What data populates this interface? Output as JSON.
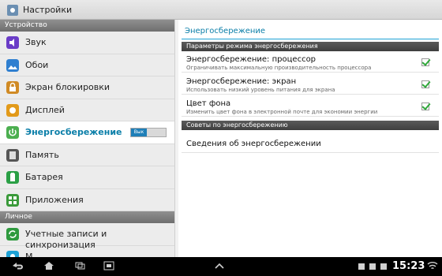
{
  "topbar": {
    "title": "Настройки",
    "icon": "settings-icon"
  },
  "sidebar": {
    "section_device": "Устройство",
    "items": [
      {
        "label": "Звук",
        "icon": "sound-icon",
        "color": "#6a3cc7"
      },
      {
        "label": "Обои",
        "icon": "wallpaper-icon",
        "color": "#2f7fd0"
      },
      {
        "label": "Экран блокировки",
        "icon": "lock-screen-icon",
        "color": "#d08a24"
      },
      {
        "label": "Дисплей",
        "icon": "display-icon",
        "color": "#e29a1a"
      },
      {
        "label": "Энергосбережение",
        "icon": "power-saving-icon",
        "color": "#4caf50",
        "selected": true,
        "toggle_label": "Вык"
      },
      {
        "label": "Память",
        "icon": "storage-icon",
        "color": "#555555"
      },
      {
        "label": "Батарея",
        "icon": "battery-icon",
        "color": "#2a9f45"
      },
      {
        "label": "Приложения",
        "icon": "apps-icon",
        "color": "#3a9a3a"
      }
    ],
    "section_personal": "Личное",
    "items2": [
      {
        "label": "Учетные записи и синхронизация",
        "icon": "sync-icon",
        "color": "#2e9a3e"
      },
      {
        "label": "М",
        "icon": "location-icon",
        "color": "#1ea2d6"
      }
    ]
  },
  "detail": {
    "title": "Энергосбережение",
    "header_params": "Параметры режима энергосбережения",
    "options": [
      {
        "title": "Энергосбережение: процессор",
        "subtitle": "Ограничивать максимальную производительность процессора",
        "checked": true
      },
      {
        "title": "Энергосбережение: экран",
        "subtitle": "Использовать низкий уровень питания для экрана",
        "checked": true
      },
      {
        "title": "Цвет фона",
        "subtitle": "Изменить цвет фона в электронной почте для экономии энергии",
        "checked": true
      }
    ],
    "header_tips": "Советы по энергосбережению",
    "tips_link": "Сведения об энергосбережении"
  },
  "bottombar": {
    "time": "15:23"
  },
  "colors": {
    "accent": "#1ea2d6",
    "selected_text": "#0a7ea8",
    "check": "#2fa83a"
  }
}
